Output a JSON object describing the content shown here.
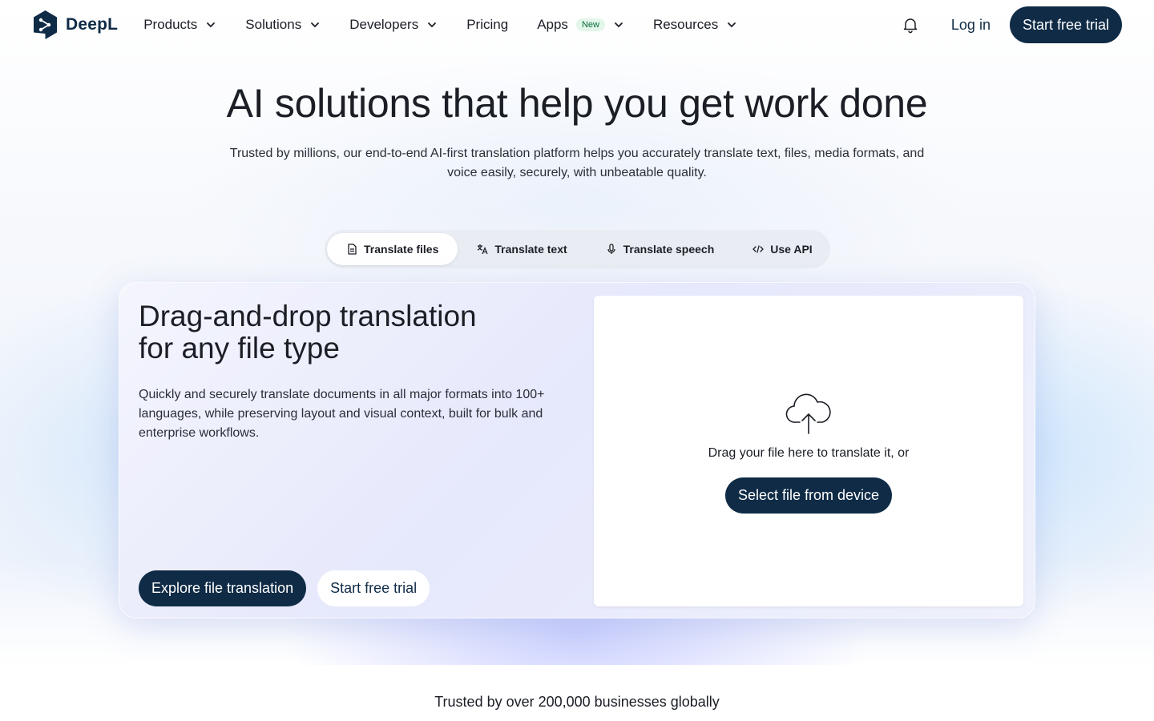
{
  "brand": {
    "name": "DeepL",
    "accent": "#0f2b46"
  },
  "nav": {
    "items": [
      {
        "label": "Products",
        "has_dropdown": true
      },
      {
        "label": "Solutions",
        "has_dropdown": true
      },
      {
        "label": "Developers",
        "has_dropdown": true
      },
      {
        "label": "Pricing",
        "has_dropdown": false
      },
      {
        "label": "Apps",
        "badge": "New",
        "has_dropdown": true
      },
      {
        "label": "Resources",
        "has_dropdown": true
      }
    ],
    "bell_icon": "bell-icon",
    "login_label": "Log in",
    "cta_label": "Start free trial"
  },
  "hero": {
    "title": "AI solutions that help you get work done",
    "subtitle": "Trusted by millions, our end-to-end AI-first translation platform helps you accurately translate text, files, media formats, and voice easily, securely, with unbeatable quality."
  },
  "tabs": [
    {
      "label": "Translate files",
      "icon": "document-icon",
      "active": true
    },
    {
      "label": "Translate text",
      "icon": "translate-icon",
      "active": false
    },
    {
      "label": "Translate speech",
      "icon": "microphone-icon",
      "active": false
    },
    {
      "label": "Use API",
      "icon": "code-icon",
      "active": false
    }
  ],
  "card": {
    "title_line1": "Drag-and-drop translation",
    "title_line2": "for any file type",
    "description": "Quickly and securely translate documents in all major formats into 100+ languages, while preserving layout and visual context, built for bulk and enterprise workflows.",
    "primary_label": "Explore file translation",
    "secondary_label": "Start free trial",
    "dropzone": {
      "icon": "cloud-upload-icon",
      "text": "Drag your file here to translate it, or",
      "button_label": "Select file from device"
    }
  },
  "trusted_text": "Trusted by over 200,000 businesses globally"
}
